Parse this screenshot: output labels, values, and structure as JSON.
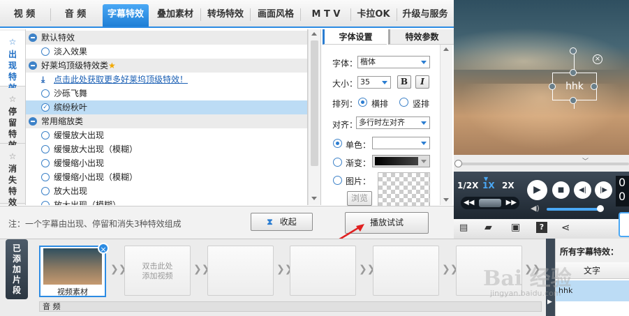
{
  "top_tabs": [
    "视 频",
    "音 频",
    "字幕特效",
    "叠加素材",
    "转场特效",
    "画面风格",
    "M T V",
    "卡拉OK",
    "升级与服务"
  ],
  "side_tabs": [
    "出现特效",
    "停留特效",
    "消失特效"
  ],
  "effect_list": [
    {
      "type": "category",
      "label": "默认特效"
    },
    {
      "type": "item",
      "label": "淡入效果"
    },
    {
      "type": "category",
      "label": "好莱坞顶级特效类"
    },
    {
      "type": "link",
      "label": "点击此处获取更多好莱坞顶级特效！"
    },
    {
      "type": "item",
      "label": "沙砾飞舞"
    },
    {
      "type": "item",
      "label": "缤纷秋叶",
      "selected": true
    },
    {
      "type": "category",
      "label": "常用缩放类"
    },
    {
      "type": "item",
      "label": "缓慢放大出现"
    },
    {
      "type": "item",
      "label": "缓慢放大出现（模糊）"
    },
    {
      "type": "item",
      "label": "缓慢缩小出现"
    },
    {
      "type": "item",
      "label": "缓慢缩小出现（模糊）"
    },
    {
      "type": "item",
      "label": "放大出现"
    },
    {
      "type": "item",
      "label": "放大出现（模糊）"
    }
  ],
  "settings_tabs": {
    "font": "字体设置",
    "effect": "特效参数"
  },
  "font_settings": {
    "font_label": "字体：",
    "font_value": "楷体",
    "size_label": "大小：",
    "size_value": "35",
    "bold": "B",
    "italic": "I",
    "arrange_label": "排列：",
    "horizontal": "横排",
    "vertical": "竖排",
    "align_label": "对齐：",
    "align_value": "多行时左对齐",
    "solid_label": "单色：",
    "gradient_label": "渐变：",
    "image_label": "图片：",
    "browse": "浏览"
  },
  "note": "注：一个字幕由出现、停留和消失3种特效组成",
  "collapse_button": "收起",
  "play_button": "播放试试",
  "preview_text": "hhk",
  "speed": {
    "half": "1/2X",
    "one": "1X",
    "two": "2X"
  },
  "time_digits": [
    "0",
    "0"
  ],
  "timeline": {
    "side_label": "已添加片段",
    "clip1_label": "视频素材",
    "add_hint": "双击此处\n添加视频",
    "audio_label": "音 频"
  },
  "right_panel": {
    "header": "所有字幕特效：",
    "col": "文字",
    "row1": "hhk"
  },
  "watermark": "Bai 经验",
  "watermark_url": "jingyan.baidu.com",
  "colors": {
    "accent": "#2b8be3",
    "selected": "#bcdcf5",
    "link": "#1a5fb4"
  }
}
